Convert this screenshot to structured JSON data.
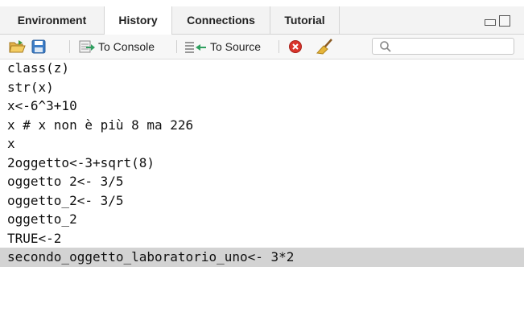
{
  "tabs": [
    {
      "label": "Environment"
    },
    {
      "label": "History"
    },
    {
      "label": "Connections"
    },
    {
      "label": "Tutorial"
    }
  ],
  "active_tab": "History",
  "toolbar": {
    "to_console_label": "To Console",
    "to_source_label": "To Source"
  },
  "history": {
    "entries": [
      "class(z)",
      "str(x)",
      "x<-6^3+10",
      "x # x non è più 8 ma 226",
      "x",
      "2oggetto<-3+sqrt(8)",
      "oggetto 2<- 3/5",
      "oggetto_2<- 3/5",
      "oggetto_2",
      "TRUE<-2",
      "secondo_oggetto_laboratorio_uno<- 3*2"
    ],
    "selected_index": 10
  },
  "colors": {
    "selected_row": "#d3d3d3",
    "tabbar_bg": "#f3f3f3",
    "delete_red": "#d9342b"
  }
}
